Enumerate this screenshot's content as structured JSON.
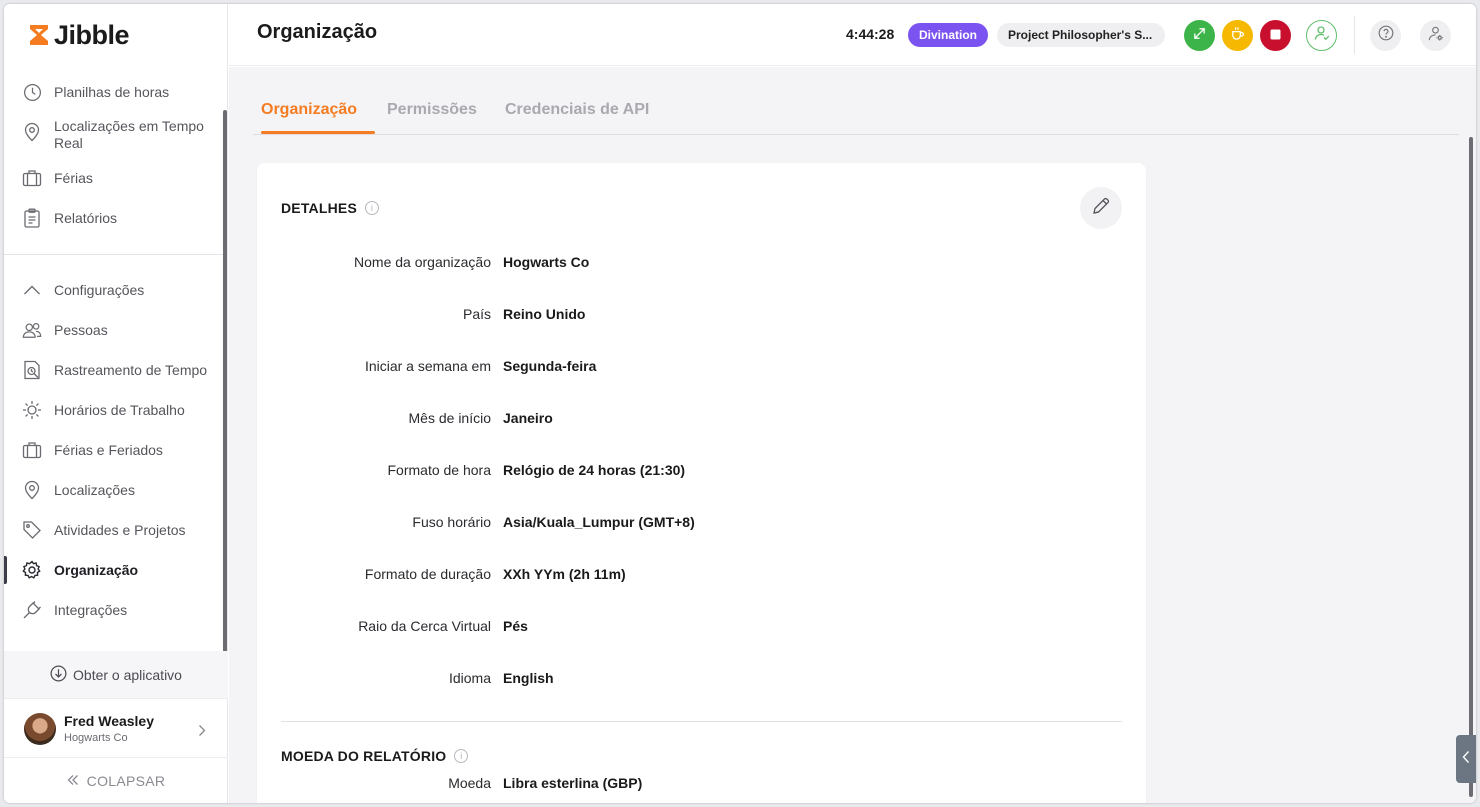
{
  "app": {
    "logo_text": "Jibble",
    "brand_color": "#f57c21"
  },
  "sidebar": {
    "top_items": [
      {
        "label": "Planilhas de horas",
        "icon": "clock-icon"
      },
      {
        "label": "Localizações em Tempo Real",
        "icon": "location-pin-icon"
      },
      {
        "label": "Férias",
        "icon": "suitcase-icon"
      },
      {
        "label": "Relatórios",
        "icon": "clipboard-icon"
      }
    ],
    "settings_items": [
      {
        "label": "Configurações",
        "icon": "chevron-up-icon"
      },
      {
        "label": "Pessoas",
        "icon": "people-icon"
      },
      {
        "label": "Rastreamento de Tempo",
        "icon": "time-tracking-icon"
      },
      {
        "label": "Horários de Trabalho",
        "icon": "work-schedule-icon"
      },
      {
        "label": "Férias e Feriados",
        "icon": "suitcase-icon"
      },
      {
        "label": "Localizações",
        "icon": "location-pin-icon"
      },
      {
        "label": "Atividades e Projetos",
        "icon": "tag-icon"
      },
      {
        "label": "Organização",
        "icon": "gear-icon",
        "active": true
      },
      {
        "label": "Integrações",
        "icon": "plug-icon"
      }
    ],
    "get_app_label": "Obter o aplicativo",
    "user": {
      "name": "Fred Weasley",
      "org": "Hogwarts Co"
    },
    "collapse_label": "COLAPSAR"
  },
  "header": {
    "title": "Organização",
    "timer": "4:44:28",
    "activity": "Divination",
    "project": "Project Philosopher's S...",
    "colors": {
      "activity": "#7b53f0",
      "clock_in": "#3db44a",
      "break": "#f6b800",
      "stop": "#c8102e"
    }
  },
  "tabs": [
    {
      "label": "Organização",
      "active": true
    },
    {
      "label": "Permissões",
      "active": false
    },
    {
      "label": "Credenciais de API",
      "active": false
    }
  ],
  "details": {
    "title": "DETALHES",
    "fields": [
      {
        "label": "Nome da organização",
        "value": "Hogwarts Co"
      },
      {
        "label": "País",
        "value": "Reino Unido"
      },
      {
        "label": "Iniciar a semana em",
        "value": "Segunda-feira"
      },
      {
        "label": "Mês de início",
        "value": "Janeiro"
      },
      {
        "label": "Formato de hora",
        "value": "Relógio de 24 horas (21:30)"
      },
      {
        "label": "Fuso horário",
        "value": "Asia/Kuala_Lumpur (GMT+8)"
      },
      {
        "label": "Formato de duração",
        "value": "XXh YYm (2h 11m)"
      },
      {
        "label": "Raio da Cerca Virtual",
        "value": "Pés"
      },
      {
        "label": "Idioma",
        "value": "English"
      }
    ]
  },
  "currency": {
    "title": "MOEDA DO RELATÓRIO",
    "fields": [
      {
        "label": "Moeda",
        "value": "Libra esterlina (GBP)"
      }
    ]
  }
}
